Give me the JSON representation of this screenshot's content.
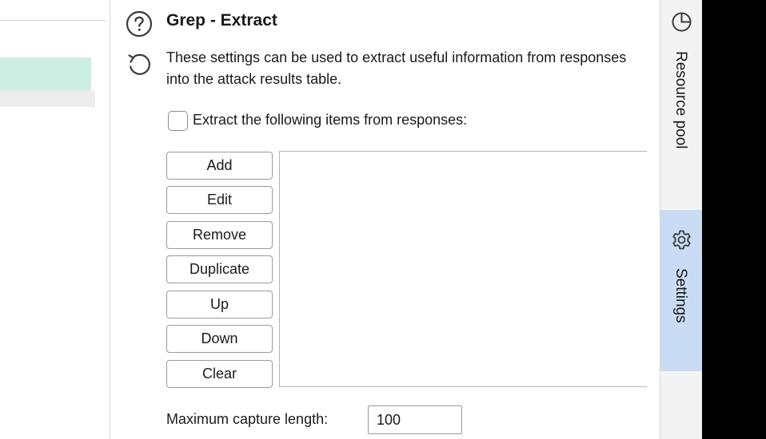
{
  "section": {
    "title": "Grep - Extract",
    "description": "These settings can be used to extract useful information from responses into the attack results table.",
    "checkbox_label": "Extract the following items from responses:",
    "checkbox_checked": false
  },
  "buttons": {
    "add": "Add",
    "edit": "Edit",
    "remove": "Remove",
    "duplicate": "Duplicate",
    "up": "Up",
    "down": "Down",
    "clear": "Clear"
  },
  "max_capture": {
    "label": "Maximum capture length:",
    "value": "100"
  },
  "right_rail": {
    "resource_pool_label": "Resource pool",
    "settings_label": "Settings"
  },
  "icons": {
    "help": "help-circle-icon",
    "reset": "reset-icon",
    "resource_pool": "pie-chart-icon",
    "settings": "gear-icon"
  },
  "colors": {
    "selected_row": "#cdeee2",
    "active_tab": "#c9dcf3"
  }
}
